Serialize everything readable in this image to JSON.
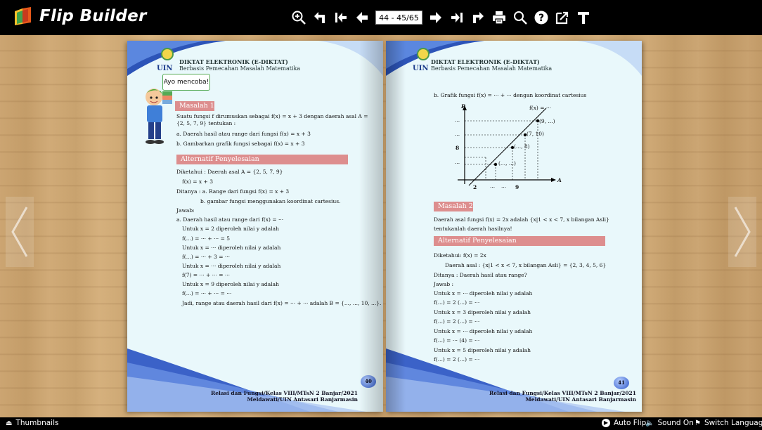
{
  "app": {
    "title": "Flip Builder"
  },
  "toolbar": {
    "page_indicator": "44 - 45/65",
    "icons": [
      "zoom-in-icon",
      "undo-icon",
      "first-page-icon",
      "prev-page-icon",
      "next-page-icon",
      "last-page-icon",
      "share-icon",
      "print-icon",
      "search-icon",
      "help-icon",
      "export-icon",
      "text-icon"
    ]
  },
  "colors": {
    "band": "#dd8e8e",
    "page_bg": "#e9f8fb",
    "topbar": "#000000",
    "wave_blue": "#5a78d6"
  },
  "left_page": {
    "header_title": "DIKTAT ELEKTRONIK (E-DIKTAT)",
    "header_sub": "Berbasis Pemecahan Masalah Matematika",
    "uin": "UIN",
    "bubble": "Ayo mencoba!",
    "masalah_label": "Masalah 1",
    "problem_lines": [
      "Suatu fungsi f dirumuskan sebagai f(x) = x + 3 dengan daerah asal A =",
      "{2, 5, 7, 9} tentukan :",
      "a.   Daerah hasil atau range dari fungsi f(x) = x + 3",
      "b.   Gambarkan grafik fungsi sebagai f(x) = x + 3"
    ],
    "alt_label": "Alternatif Penyelesaian",
    "solution_lines": [
      "Diketahui : Daerah asal  A = {2, 5, 7, 9}",
      "f(x) = x + 3",
      "Ditanya : a. Range dari fungsi f(x) = x + 3",
      "b. gambar fungsi menggunakan koordinat cartesius.",
      "Jawab:",
      "a.  Daerah hasil atau range dari f(x) = ···",
      "Untuk  x = 2  diperoleh nilai y adalah",
      "f(...) = ··· + ··· = 5",
      "Untuk x = ··· diperoleh nilai y adalah",
      "f(...) = ··· + 3 = ···",
      "Untuk x = ··· diperoleh nilai y adalah",
      "f(7) = ··· + ··· = ···",
      "Untuk x = 9 diperoleh nilai y adalah",
      "f(...) = ··· + ··· = ···",
      "Jadi, range atau daerah hasil dari f(x) = ··· + ··· adalah B = {..., ..., 10, ...}."
    ],
    "page_number": "40",
    "footer_1": "Relasi dan Fungsi/Kelas VIII/MTsN 2 Banjar/2021",
    "footer_2": "Meldawati/UIN Antasari Banjarmasin"
  },
  "right_page": {
    "header_title": "DIKTAT ELEKTRONIK (E-DIKTAT)",
    "header_sub": "Berbasis Pemecahan Masalah Matematika",
    "uin": "UIN",
    "graph_caption": "b.   Grafik fungsi f(x) = ··· + ··· dengan koordinat cartesius",
    "graph": {
      "axis_y": "B",
      "axis_x": "A",
      "func": "f(x) = ···",
      "y_ticks": [
        "···",
        "···",
        "8",
        "···"
      ],
      "x_ticks": [
        "2",
        "···",
        "···",
        "9"
      ],
      "point_labels": [
        "(9, ...)",
        "(7, 10)",
        "(..., 8)",
        "(..., ...)"
      ]
    },
    "masalah_label": "Masalah 2",
    "problem_lines": [
      "Daerah    asal    fungsi    f(x) = 2x    adalah    {x|1 < x < 7,  x bilangan Asli}",
      "tentukanlah daerah hasilnya!"
    ],
    "alt_label": "Alternatif Penyelesaian",
    "solution_lines": [
      "Diketahui: f(x) = 2x",
      "Daerah asal : {x|1 < x < 7,  x bilangan Asli} = {2, 3, 4, 5, 6}",
      "Ditanya : Daerah hasil atau range?",
      "Jawab :",
      "Untuk x = ··· diperoleh nilai y adalah",
      "f(...) = 2 (...) = ···",
      "Untuk x = 3 diperoleh nilai y adalah",
      "f(...) = 2 (...) = ···",
      "Untuk x = ··· diperoleh nilai y adalah",
      "f(...) = ··· (4) = ···",
      "Untuk x = 5 diperoleh nilai y adalah",
      "f(...) = 2 (...) = ···"
    ],
    "page_number": "41",
    "footer_1": "Relasi dan Fungsi/Kelas VIII/MTsN 2 Banjar/2021",
    "footer_2": "Meldawati/UIN Antasari Banjarmasin"
  },
  "bottombar": {
    "thumbnails": "Thumbnails",
    "auto_flip": "Auto Flip",
    "sound_on": "Sound On",
    "switch_language": "Switch Language"
  }
}
